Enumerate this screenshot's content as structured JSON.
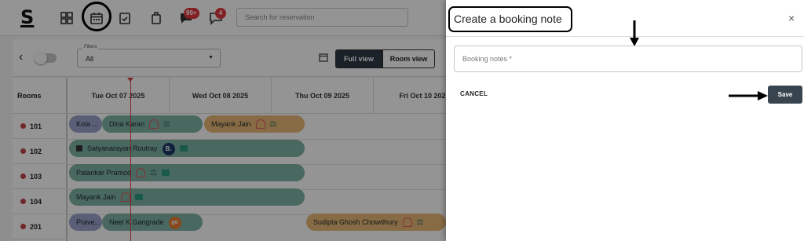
{
  "app": {
    "logo": "S",
    "search_placeholder": "Search for reservation",
    "badges": {
      "notifications": "99+",
      "messages": "4"
    }
  },
  "toolbar": {
    "filter_legend": "Filters",
    "filter_value": "All",
    "full_view_label": "Full view",
    "room_view_label": "Room view"
  },
  "grid": {
    "rooms_header": "Rooms",
    "days": [
      "Tue Oct 07 2025",
      "Wed Oct 08 2025",
      "Thu Oct 09 2025",
      "Fri Oct 10 2025"
    ],
    "rooms": [
      "101",
      "102",
      "103",
      "104",
      "201"
    ],
    "bookings": [
      {
        "label": "Kola ...",
        "color": "#9ba2cc"
      },
      {
        "label": "Dina Karan",
        "color": "#7fb3a6"
      },
      {
        "label": "Mayank Jain",
        "color": "#e8b977"
      },
      {
        "label": "Satyanarayan Routray",
        "color": "#7fb3a6"
      },
      {
        "label": "Patankar Pramod",
        "color": "#7fb3a6"
      },
      {
        "label": "Mayank Jain",
        "color": "#7fb3a6"
      },
      {
        "label": "Prave...",
        "color": "#9ba2cc"
      },
      {
        "label": "Neel K Gangrade",
        "color": "#7fb3a6"
      },
      {
        "label": "Sudipta Ghosh Chowdhury",
        "color": "#e8b977"
      }
    ],
    "booking_icon_b": "B.",
    "booking_icon_go": "go"
  },
  "drawer": {
    "title": "Create a booking note",
    "close_label": "×",
    "notes_placeholder": "Booking notes *",
    "cancel_label": "CANCEL",
    "save_label": "Save"
  }
}
